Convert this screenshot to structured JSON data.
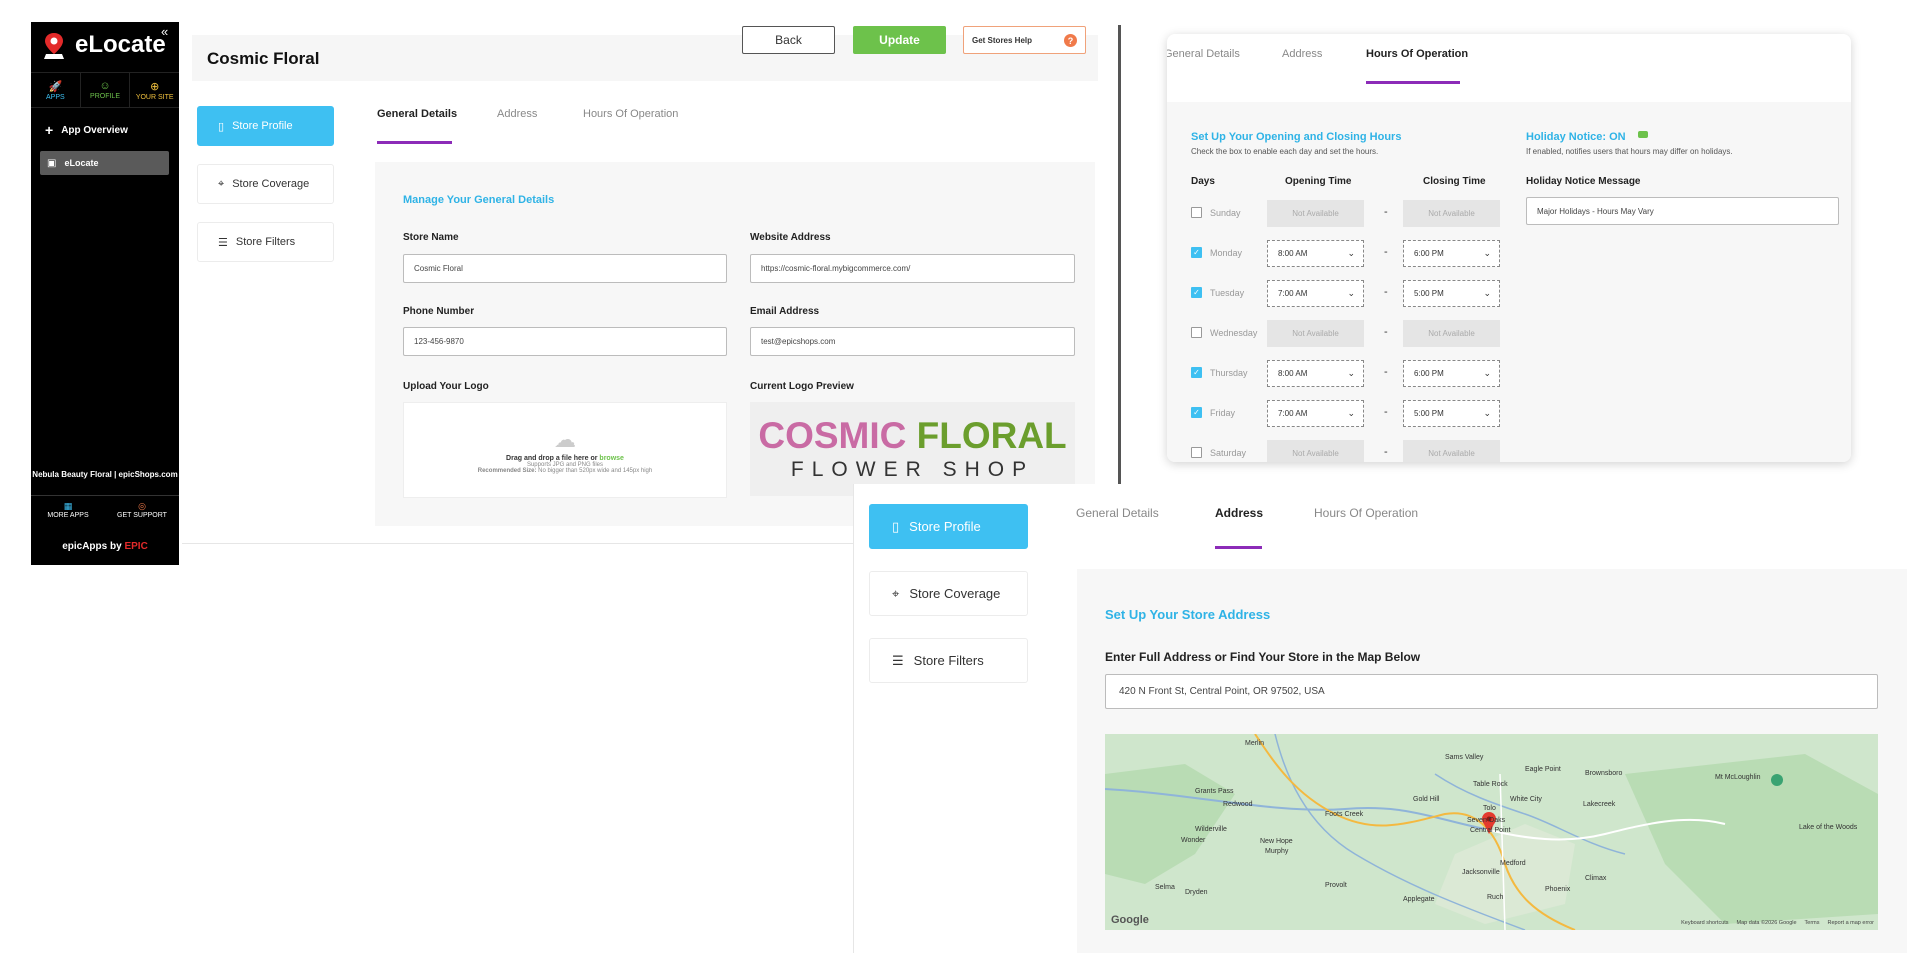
{
  "sidebar": {
    "collapse_icon": "«",
    "app_name": "eLocate",
    "nav": [
      {
        "label": "APPS",
        "icon": "rocket-icon",
        "color": "#3ec0f2"
      },
      {
        "label": "PROFILE",
        "icon": "profile-icon",
        "color": "#6dc24b"
      },
      {
        "label": "YOUR SITE",
        "icon": "globe-icon",
        "color": "#f2c23e"
      }
    ],
    "overview_label": "App Overview",
    "active_app_label": "eLocate",
    "store_label": "Nebula Beauty Floral | epicShops.com",
    "bottom": [
      {
        "label": "MORE APPS",
        "icon": "grid-icon"
      },
      {
        "label": "GET SUPPORT",
        "icon": "support-icon"
      }
    ],
    "brand_prefix": "epicApps by",
    "brand_epic": "EPIC"
  },
  "header": {
    "title": "Cosmic Floral",
    "back_label": "Back",
    "update_label": "Update",
    "help_label": "Get Stores Help",
    "help_icon": "?"
  },
  "side_menu": [
    {
      "label": "Store Profile",
      "icon": "profile-card-icon"
    },
    {
      "label": "Store Coverage",
      "icon": "map-icon"
    },
    {
      "label": "Store Filters",
      "icon": "filters-icon"
    }
  ],
  "tabs": [
    "General Details",
    "Address",
    "Hours Of Operation"
  ],
  "general": {
    "section_title": "Manage Your General Details",
    "store_name_label": "Store Name",
    "store_name_value": "Cosmic Floral",
    "website_label": "Website Address",
    "website_value": "https://cosmic-floral.mybigcommerce.com/",
    "phone_label": "Phone Number",
    "phone_value": "123-456-9870",
    "email_label": "Email Address",
    "email_value": "test@epicshops.com",
    "upload_label": "Upload Your Logo",
    "upload_drag": "Drag and drop a file here or",
    "upload_browse": "browse",
    "upload_supports": "Supports JPG and PNG files",
    "upload_recommended_label": "Recommended Size:",
    "upload_recommended": "No bigger than 520px wide and 145px high",
    "logo_preview_label": "Current Logo Preview",
    "logo_word1": "COSMIC",
    "logo_word2": "FLORAL",
    "logo_sub": "FLOWER SHOP"
  },
  "hours": {
    "tab_general_partial": "General Details",
    "tab_address": "Address",
    "tab_hours": "Hours Of Operation",
    "section_title": "Set Up Your Opening and Closing Hours",
    "section_sub": "Check the box to enable each day and set the hours.",
    "col_days": "Days",
    "col_open": "Opening Time",
    "col_close": "Closing Time",
    "not_available": "Not Available",
    "days": [
      {
        "name": "Sunday",
        "checked": false,
        "open": "",
        "close": ""
      },
      {
        "name": "Monday",
        "checked": true,
        "open": "8:00 AM",
        "close": "6:00 PM"
      },
      {
        "name": "Tuesday",
        "checked": true,
        "open": "7:00 AM",
        "close": "5:00 PM"
      },
      {
        "name": "Wednesday",
        "checked": false,
        "open": "",
        "close": ""
      },
      {
        "name": "Thursday",
        "checked": true,
        "open": "8:00 AM",
        "close": "6:00 PM"
      },
      {
        "name": "Friday",
        "checked": true,
        "open": "7:00 AM",
        "close": "5:00 PM"
      },
      {
        "name": "Saturday",
        "checked": false,
        "open": "",
        "close": ""
      }
    ],
    "holiday_title": "Holiday Notice: ON",
    "holiday_sub": "If enabled, notifies users that hours may differ on holidays.",
    "holiday_msg_label": "Holiday Notice Message",
    "holiday_msg_value": "Major Holidays - Hours May Vary"
  },
  "address": {
    "section_title": "Set Up Your Store Address",
    "field_label": "Enter Full Address or Find Your Store in the Map Below",
    "field_value": "420 N Front St, Central Point, OR 97502, USA",
    "map_labels": [
      "Merlin",
      "Sams Valley",
      "Eagle Point",
      "Brownsboro",
      "Mt McLoughlin",
      "Grants Pass",
      "Table Rock",
      "Redwood",
      "Gold Hill",
      "White City",
      "Lakecreek",
      "Foots Creek",
      "Tolo",
      "Seven Oaks",
      "Central Point",
      "Wilderville",
      "Wonder",
      "New Hope",
      "Murphy",
      "Lake of the Woods",
      "Medford",
      "Jacksonville",
      "Climax",
      "Provolt",
      "Selma",
      "Dryden",
      "Applegate",
      "Ruch",
      "Phoenix"
    ],
    "map_footer": [
      "Keyboard shortcuts",
      "Map data ©2026 Google",
      "Terms",
      "Report a map error"
    ],
    "google": "Google"
  },
  "colors": {
    "accent_blue": "#3ec0f2",
    "accent_green": "#6dc24b",
    "tab_underline": "#8c2bb8",
    "help_orange": "#f07a4a"
  }
}
